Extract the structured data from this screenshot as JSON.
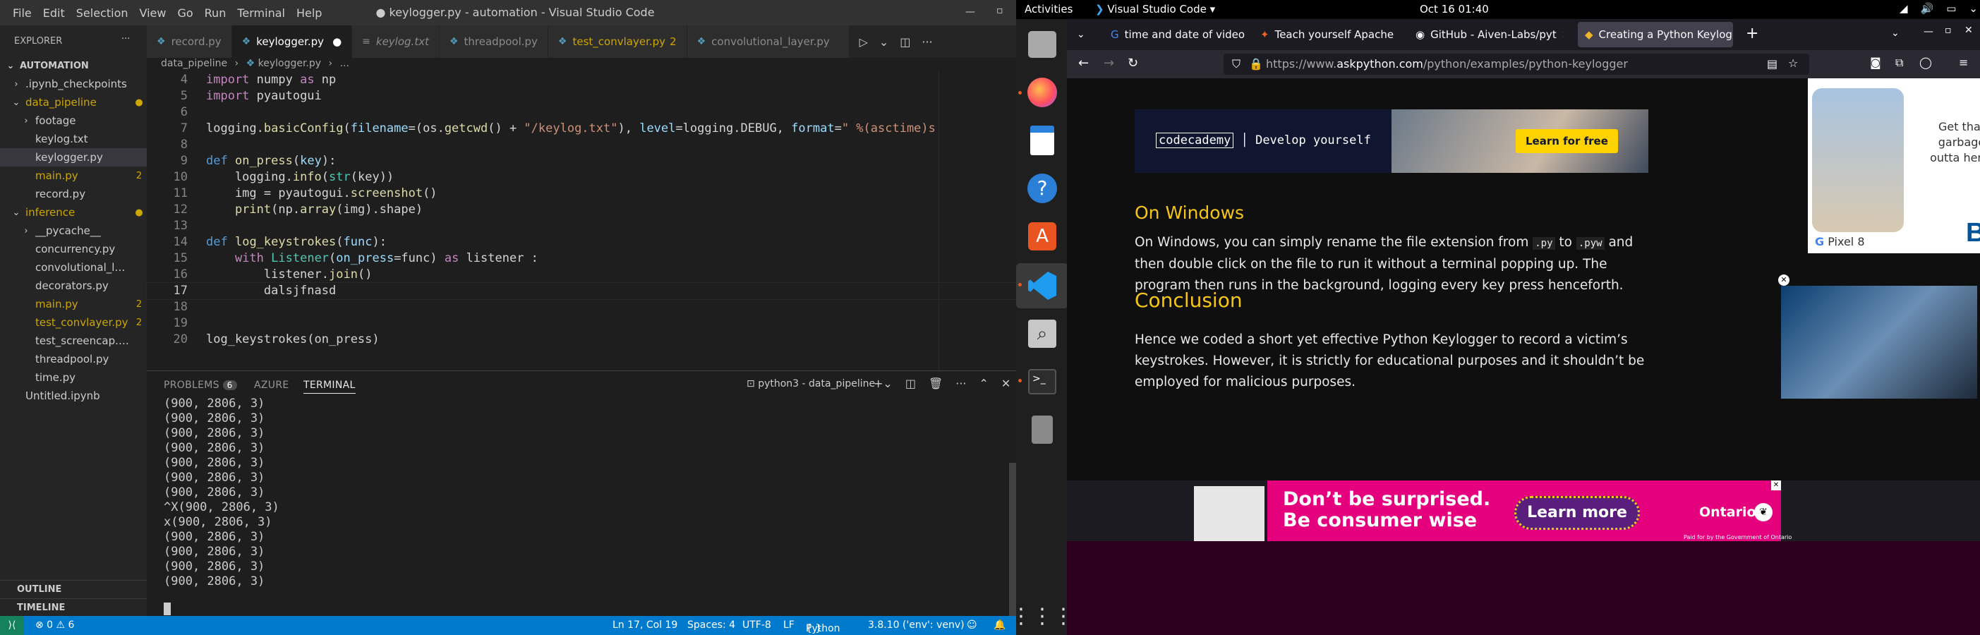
{
  "vscode": {
    "title": "● keylogger.py - automation - Visual Studio Code",
    "menu": [
      "File",
      "Edit",
      "Selection",
      "View",
      "Go",
      "Run",
      "Terminal",
      "Help"
    ],
    "explorer_label": "EXPLORER",
    "root": "AUTOMATION",
    "tree": [
      {
        "label": ".ipynb_checkpoints",
        "indent": 1,
        "kind": "folder-closed",
        "color": "#cccccc",
        "badge": ""
      },
      {
        "label": "data_pipeline",
        "indent": 1,
        "kind": "folder-open",
        "color": "#cca700",
        "badge": "●"
      },
      {
        "label": "footage",
        "indent": 2,
        "kind": "folder-closed",
        "color": "#cccccc",
        "badge": ""
      },
      {
        "label": "keylog.txt",
        "indent": 2,
        "kind": "file",
        "color": "#cccccc",
        "badge": ""
      },
      {
        "label": "keylogger.py",
        "indent": 2,
        "kind": "file",
        "color": "#cccccc",
        "badge": "",
        "active": true
      },
      {
        "label": "main.py",
        "indent": 2,
        "kind": "file",
        "color": "#cca700",
        "badge": "2"
      },
      {
        "label": "record.py",
        "indent": 2,
        "kind": "file",
        "color": "#cccccc",
        "badge": ""
      },
      {
        "label": "inference",
        "indent": 1,
        "kind": "folder-open",
        "color": "#cca700",
        "badge": "●"
      },
      {
        "label": "__pycache__",
        "indent": 2,
        "kind": "folder-closed",
        "color": "#cccccc",
        "badge": ""
      },
      {
        "label": "concurrency.py",
        "indent": 2,
        "kind": "file",
        "color": "#cccccc",
        "badge": ""
      },
      {
        "label": "convolutional_layer....",
        "indent": 2,
        "kind": "file",
        "color": "#cccccc",
        "badge": ""
      },
      {
        "label": "decorators.py",
        "indent": 2,
        "kind": "file",
        "color": "#cccccc",
        "badge": ""
      },
      {
        "label": "main.py",
        "indent": 2,
        "kind": "file",
        "color": "#cca700",
        "badge": "2"
      },
      {
        "label": "test_convlayer.py",
        "indent": 2,
        "kind": "file",
        "color": "#cca700",
        "badge": "2"
      },
      {
        "label": "test_screencap.py",
        "indent": 2,
        "kind": "file",
        "color": "#cccccc",
        "badge": ""
      },
      {
        "label": "threadpool.py",
        "indent": 2,
        "kind": "file",
        "color": "#cccccc",
        "badge": ""
      },
      {
        "label": "time.py",
        "indent": 2,
        "kind": "file",
        "color": "#cccccc",
        "badge": ""
      },
      {
        "label": "Untitled.ipynb",
        "indent": 1,
        "kind": "file",
        "color": "#cccccc",
        "badge": ""
      }
    ],
    "outline": "OUTLINE",
    "timeline": "TIMELINE",
    "tabs": [
      {
        "label": "record.py",
        "active": false,
        "italic": false,
        "color": "#8b8b8b",
        "badge": ""
      },
      {
        "label": "keylogger.py",
        "active": true,
        "italic": false,
        "color": "#ffffff",
        "badge": "●"
      },
      {
        "label": "keylog.txt",
        "active": false,
        "italic": true,
        "color": "#8b8b8b",
        "badge": ""
      },
      {
        "label": "threadpool.py",
        "active": false,
        "italic": false,
        "color": "#8b8b8b",
        "badge": ""
      },
      {
        "label": "test_convlayer.py",
        "active": false,
        "italic": false,
        "color": "#cca700",
        "badge": "2"
      },
      {
        "label": "convolutional_layer.py",
        "active": false,
        "italic": false,
        "color": "#8b8b8b",
        "badge": ""
      }
    ],
    "breadcrumb": [
      "data_pipeline",
      "keylogger.py",
      "..."
    ],
    "code": [
      {
        "n": "4",
        "html": "<span style='color:#c586c0'>import</span> numpy <span style='color:#c586c0'>as</span> np"
      },
      {
        "n": "5",
        "html": "<span style='color:#c586c0'>import</span> pyautogui"
      },
      {
        "n": "6",
        "html": ""
      },
      {
        "n": "7",
        "html": "logging.<span style='color:#dcdcaa'>basicConfig</span>(<span style='color:#9cdcfe'>filename</span>=(os.<span style='color:#dcdcaa'>getcwd</span>() + <span style='color:#ce9178'>\"/keylog.txt\"</span>), <span style='color:#9cdcfe'>level</span>=logging.DEBUG, <span style='color:#9cdcfe'>format</span>=<span style='color:#ce9178'>\" %(asctime)s</span>"
      },
      {
        "n": "8",
        "html": ""
      },
      {
        "n": "9",
        "html": "<span style='color:#569cd6'>def</span> <span style='color:#dcdcaa'>on_press</span>(<span style='color:#9cdcfe'>key</span>):"
      },
      {
        "n": "10",
        "html": "    logging.<span style='color:#dcdcaa'>info</span>(<span style='color:#4ec9b0'>str</span>(key))"
      },
      {
        "n": "11",
        "html": "    img = pyautogui.<span style='color:#dcdcaa'>screenshot</span>()"
      },
      {
        "n": "12",
        "html": "    <span style='color:#dcdcaa'>print</span>(np.<span style='color:#dcdcaa'>array</span>(img).shape)"
      },
      {
        "n": "13",
        "html": ""
      },
      {
        "n": "14",
        "html": "<span style='color:#569cd6'>def</span> <span style='color:#dcdcaa'>log_keystrokes</span>(<span style='color:#9cdcfe'>func</span>):"
      },
      {
        "n": "15",
        "html": "    <span style='color:#c586c0'>with</span> <span style='color:#4ec9b0'>Listener</span>(<span style='color:#9cdcfe'>on_press</span>=func) <span style='color:#c586c0'>as</span> listener :"
      },
      {
        "n": "16",
        "html": "        listener.<span style='color:#dcdcaa'>join</span>()"
      },
      {
        "n": "17",
        "html": "        dalsjfnasd"
      },
      {
        "n": "18",
        "html": ""
      },
      {
        "n": "19",
        "html": ""
      },
      {
        "n": "20",
        "html": "log_keystrokes(on_press)"
      }
    ],
    "panel_tabs": {
      "problems": "PROBLEMS",
      "problems_count": "6",
      "azure": "AZURE",
      "terminal": "TERMINAL"
    },
    "terminal_name": "python3 - data_pipeline",
    "terminal": [
      "(900, 2806, 3)",
      "(900, 2806, 3)",
      "(900, 2806, 3)",
      "(900, 2806, 3)",
      "(900, 2806, 3)",
      "(900, 2806, 3)",
      "(900, 2806, 3)",
      "^X(900, 2806, 3)",
      "x(900, 2806, 3)",
      "(900, 2806, 3)",
      "(900, 2806, 3)",
      "(900, 2806, 3)",
      "(900, 2806, 3)"
    ],
    "status": {
      "errors": "⊗ 0 ⚠ 6",
      "position": "Ln 17, Col 19",
      "spaces": "Spaces: 4",
      "encoding": "UTF-8",
      "eol": "LF",
      "language": "Python",
      "interpreter": "3.8.10 ('env': venv)"
    }
  },
  "ubuntu": {
    "activities": "Activities",
    "app": "Visual Studio Code ▾",
    "clock": "Oct 16  01:40"
  },
  "firefox": {
    "tabs": [
      "time and date of video fi",
      "Teach yourself Apache K",
      "GitHub - Aiven-Labs/pyt",
      "Creating a Python Keylog"
    ],
    "url_prefix": "https://www.",
    "url_domain": "askpython.com",
    "url_path": "/python/examples/python-keylogger",
    "article": {
      "h_windows": "On Windows",
      "p1a": "On Windows, you can simply rename the file extension from ",
      "p1_code1": ".py",
      "p1b": " to ",
      "p1_code2": ".pyw",
      "p1c": " and then double click on the file to run it without a terminal popping up. The program then runs in the background, logging every key press henceforth.",
      "h_conclusion": "Conclusion",
      "p2": "Hence we coded a short yet effective Python Keylogger to record a victim’s keystrokes. However, it is strictly for educational purposes and it shouldn’t be employed for malicious purposes."
    },
    "ad_codecademy": {
      "brand": "codecademy",
      "tagline": "Develop yourself",
      "cta": "Learn for free"
    },
    "ad_pixel": {
      "headline": "Get that garbage outta here!",
      "product": "Pixel 8",
      "brand": "Bell"
    },
    "ad_ontario": {
      "line1": "Don’t be surprised.",
      "line2": "Be consumer wise",
      "cta": "Learn more",
      "brand": "Ontario",
      "footer": "Paid for by the Government of Ontario"
    }
  },
  "colors": {
    "vscode_blue": "#007acc",
    "modified": "#cca700",
    "ontario_pink": "#e5007d",
    "firefox_bg": "#1c1b22"
  }
}
